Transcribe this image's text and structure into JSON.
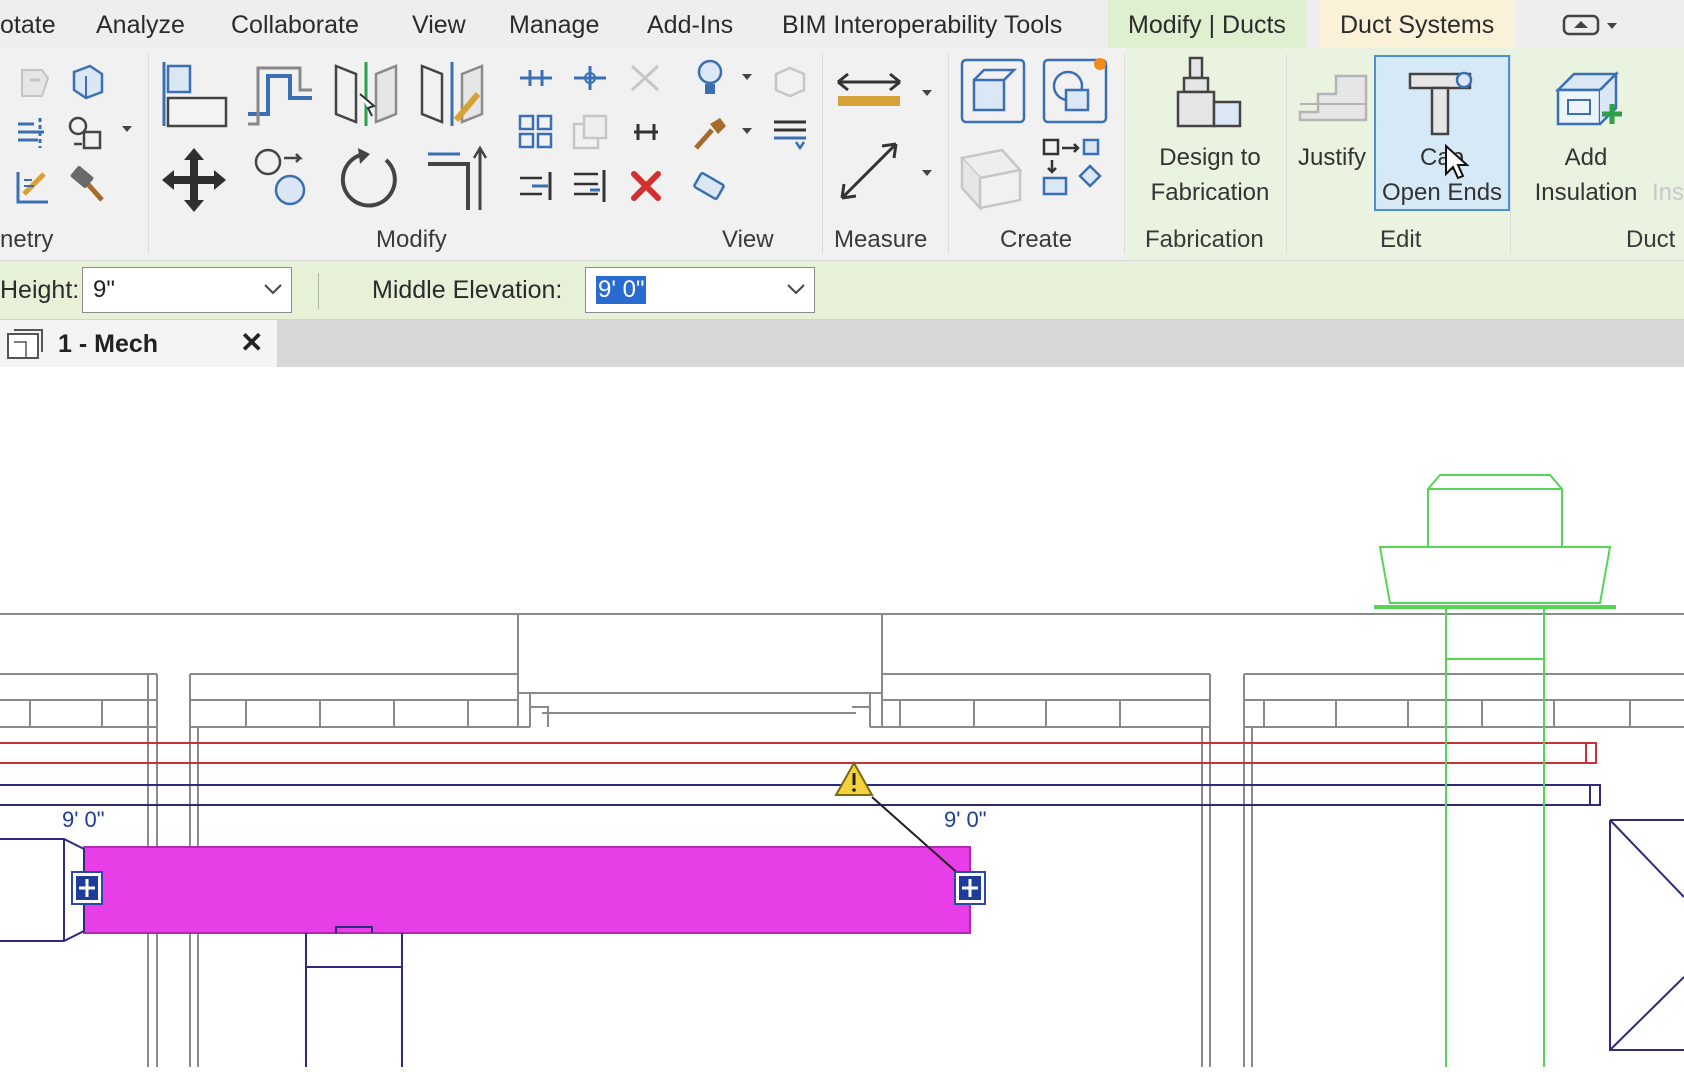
{
  "menubar": {
    "items": [
      "otate",
      "Analyze",
      "Collaborate",
      "View",
      "Manage",
      "Add-Ins",
      "BIM Interoperability Tools"
    ],
    "active_tab": "Modify | Ducts",
    "context_tab": "Duct Systems"
  },
  "ribbon": {
    "panels": {
      "geometry": "netry",
      "modify": "Modify",
      "view": "View",
      "measure": "Measure",
      "create": "Create",
      "fabrication": "Fabrication",
      "edit": "Edit",
      "duct": "Duct"
    },
    "buttons": {
      "design_to_fabrication": [
        "Design to",
        "Fabrication"
      ],
      "justify": "Justify",
      "cap_open_ends": [
        "Cap",
        "Open Ends"
      ],
      "add_insulation": [
        "Add",
        "Insulation"
      ],
      "ins_partial": "Ins"
    }
  },
  "options": {
    "height_label": "Height:",
    "height_value": "9\"",
    "middle_elevation_label": "Middle Elevation:",
    "middle_elevation_value": "9'  0\""
  },
  "view_tab": {
    "title": "1 - Mech",
    "close": "✕"
  },
  "drawing": {
    "elevation_left": "9'  0\"",
    "elevation_right": "9'  0\"",
    "duct_color": "#e83ee8",
    "mech_equipment_color": "#55d455",
    "pipe_red": "#c8323c",
    "pipe_blue": "#2c2c7a"
  }
}
